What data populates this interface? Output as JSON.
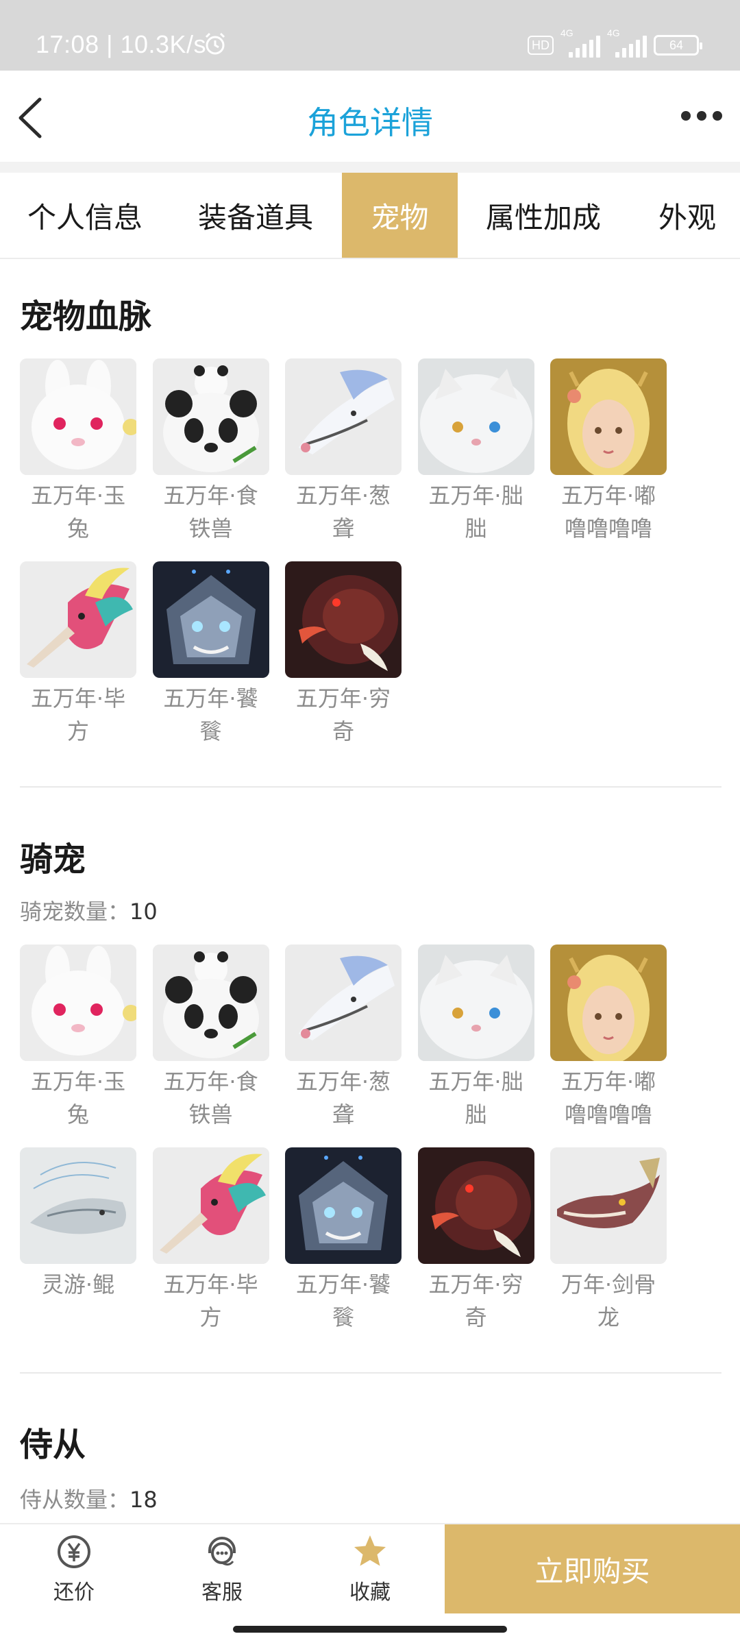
{
  "status_bar": {
    "time": "17:08",
    "speed": "10.3K/s",
    "hd": "HD",
    "network1": "4G",
    "network2": "4G",
    "battery": "64"
  },
  "header": {
    "title": "角色详情",
    "title_color": "#1ba2d9",
    "back_icon": "chevron-left-icon",
    "more_icon": "more-dots-icon"
  },
  "tabs": [
    {
      "label": "个人信息",
      "active": false
    },
    {
      "label": "装备道具",
      "active": false
    },
    {
      "label": "宠物",
      "active": true
    },
    {
      "label": "属性加成",
      "active": false
    },
    {
      "label": "外观",
      "active": false
    }
  ],
  "accent_color": "#dcb86b",
  "pet_bloodline": {
    "title": "宠物血脉",
    "pets": [
      {
        "line1": "五万年·玉",
        "line2": "兔",
        "image": "white-rabbit"
      },
      {
        "line1": "五万年·食",
        "line2": "铁兽",
        "image": "panda"
      },
      {
        "line1": "五万年·葱",
        "line2": "聋",
        "image": "white-dragon"
      },
      {
        "line1": "五万年·朏",
        "line2": "朏",
        "image": "white-cat"
      },
      {
        "line1": "五万年·嘟",
        "line2": "噜噜噜噜",
        "image": "blonde-girl"
      },
      {
        "line1": "五万年·毕",
        "line2": "方",
        "image": "rainbow-bird"
      },
      {
        "line1": "五万年·饕",
        "line2": "餮",
        "image": "armored-beast"
      },
      {
        "line1": "五万年·穷",
        "line2": "奇",
        "image": "red-boar"
      }
    ]
  },
  "mounts": {
    "title": "骑宠",
    "count_label": "骑宠数量：",
    "count_value": "10",
    "pets": [
      {
        "line1": "五万年·玉",
        "line2": "兔",
        "image": "white-rabbit"
      },
      {
        "line1": "五万年·食",
        "line2": "铁兽",
        "image": "panda"
      },
      {
        "line1": "五万年·葱",
        "line2": "聋",
        "image": "white-dragon"
      },
      {
        "line1": "五万年·朏",
        "line2": "朏",
        "image": "white-cat"
      },
      {
        "line1": "五万年·嘟",
        "line2": "噜噜噜噜",
        "image": "blonde-girl"
      },
      {
        "line1": "灵游·鲲",
        "line2": "",
        "image": "silver-fish"
      },
      {
        "line1": "五万年·毕",
        "line2": "方",
        "image": "rainbow-bird"
      },
      {
        "line1": "五万年·饕",
        "line2": "餮",
        "image": "armored-beast"
      },
      {
        "line1": "五万年·穷",
        "line2": "奇",
        "image": "red-boar"
      },
      {
        "line1": "万年·剑骨",
        "line2": "龙",
        "image": "bone-dragon"
      }
    ]
  },
  "followers": {
    "title": "侍从",
    "count_label": "侍从数量：",
    "count_value": "18"
  },
  "bottom_bar": {
    "bargain_label": "还价",
    "bargain_icon": "yuan-circle-icon",
    "service_label": "客服",
    "service_icon": "headset-icon",
    "favorite_label": "收藏",
    "favorite_icon": "star-icon",
    "buy_label": "立即购买"
  }
}
